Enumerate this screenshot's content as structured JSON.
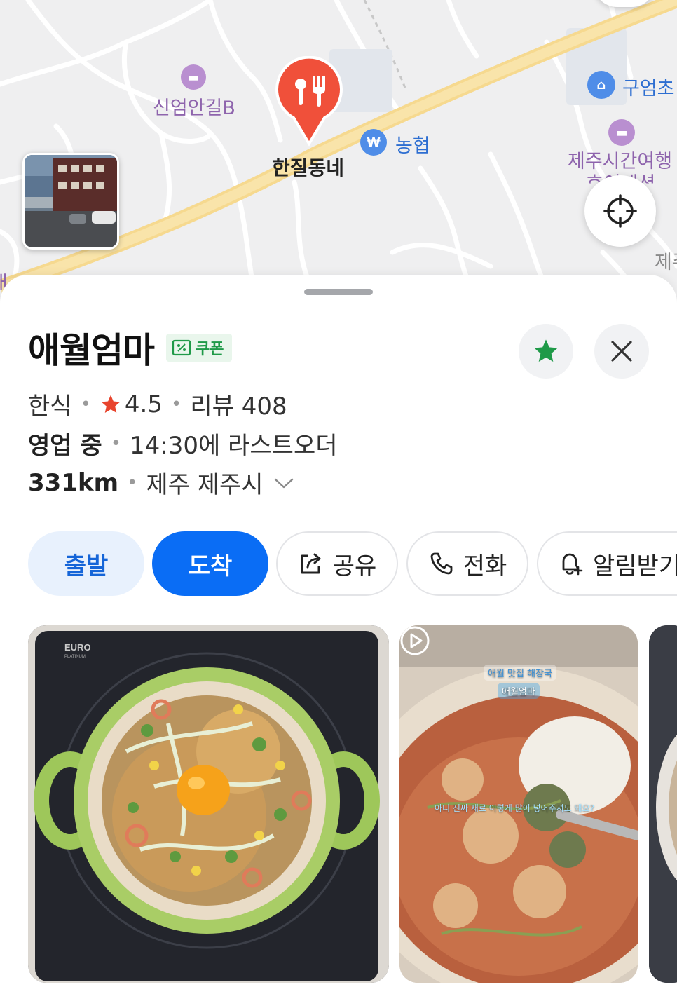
{
  "map": {
    "pins": [
      {
        "label": "신엄안길B",
        "kind": "lodging"
      },
      {
        "label": "한질동네",
        "kind": "restaurant-selected"
      },
      {
        "label": "농협",
        "kind": "bank"
      },
      {
        "label": "구엄초",
        "kind": "school"
      },
      {
        "label": "제주시간여행",
        "kind": "lodging"
      },
      {
        "label": "호이게션",
        "kind": "partial"
      },
      {
        "label": "제주",
        "kind": "partial"
      },
      {
        "label": "애",
        "kind": "partial"
      }
    ],
    "bank_glyph": "₩"
  },
  "place": {
    "name": "애월엄마",
    "coupon_label": "쿠폰",
    "category": "한식",
    "rating": "4.5",
    "review_label": "리뷰 408",
    "status": "영업 중",
    "last_order": "14:30에 라스트오더",
    "distance": "331km",
    "address": "제주 제주시"
  },
  "actions": {
    "depart": "출발",
    "arrive": "도착",
    "share": "공유",
    "call": "전화",
    "alert": "알림받기"
  },
  "photos": {
    "photo1_brand": "EURO",
    "photo1_brand_sub": "PLATINUM",
    "photo2_caption_1": "애월 맛집 해장국",
    "photo2_caption_2": "애월엄마",
    "photo2_caption_3": "아니 진짜 재료 이렇게 많이 넣어주셔도 돼요?"
  },
  "colors": {
    "accent": "#0a6df5",
    "favorite_star": "#1f9a48",
    "rating_star": "#e8442d",
    "coupon": "#1f9a48"
  }
}
